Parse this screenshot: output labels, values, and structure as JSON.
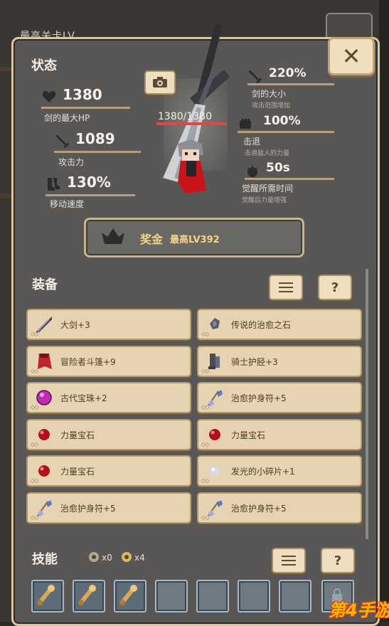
{
  "background": {
    "title": "最高关卡LV"
  },
  "stats": {
    "title": "状态",
    "hp": {
      "value": "1380",
      "label": "剑的最大HP"
    },
    "attack": {
      "value": "1089",
      "label": "攻击力"
    },
    "speed": {
      "value": "130%",
      "label": "移动速度"
    },
    "sword_size": {
      "value": "220%",
      "label": "剑的大小",
      "sub": "攻击范围增加"
    },
    "knockback": {
      "value": "100%",
      "label": "击退",
      "sub": "击退敌人的力量"
    },
    "awaken_time": {
      "value": "50s",
      "label": "觉醒所需时间",
      "sub": "觉醒后力量增强"
    },
    "sword_hp": "1380/1380"
  },
  "bonus": {
    "label": "奖金",
    "level": "最高LV392"
  },
  "equipment": {
    "title": "装备",
    "list_label": "≡",
    "help_label": "?",
    "items": [
      {
        "name": "大剑+3",
        "icon": "greatsword-icon"
      },
      {
        "name": "传说的治愈之石",
        "icon": "healing-stone-icon"
      },
      {
        "name": "冒险者斗篷+9",
        "icon": "cape-icon"
      },
      {
        "name": "骑士护胫+3",
        "icon": "greaves-icon"
      },
      {
        "name": "古代宝珠+2",
        "icon": "orb-icon"
      },
      {
        "name": "治愈护身符+5",
        "icon": "amulet-icon"
      },
      {
        "name": "力量宝石",
        "icon": "red-gem-icon"
      },
      {
        "name": "力量宝石",
        "icon": "red-gem-icon"
      },
      {
        "name": "力量宝石",
        "icon": "red-gem-icon"
      },
      {
        "name": "发光的小碎片+1",
        "icon": "shard-icon"
      },
      {
        "name": "治愈护身符+5",
        "icon": "amulet-icon"
      },
      {
        "name": "治愈护身符+5",
        "icon": "amulet-icon"
      }
    ]
  },
  "skills": {
    "title": "技能",
    "count_a": "x0",
    "count_b": "x4",
    "list_label": "≡",
    "help_label": "?"
  },
  "watermark": "第4手游",
  "colors": {
    "accent": "#f3d58a",
    "hp_bar": "#e04848",
    "panel": "#595756"
  }
}
